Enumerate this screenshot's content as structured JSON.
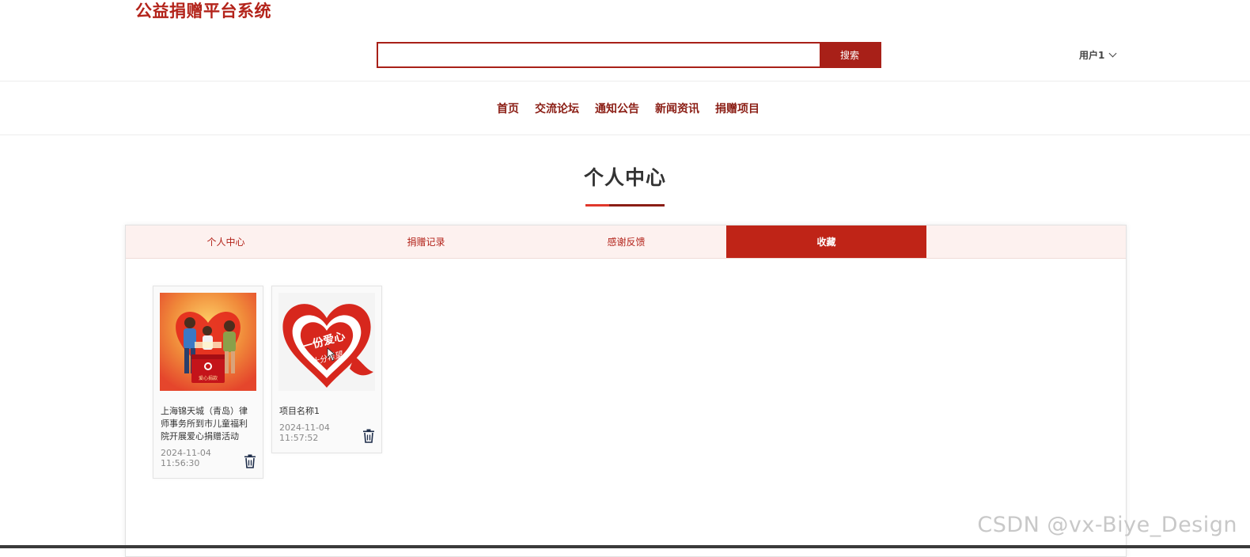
{
  "header": {
    "brand": "公益捐赠平台系统",
    "search": {
      "value": "",
      "placeholder": "",
      "button_label": "搜索"
    },
    "user_label": "用户1"
  },
  "nav": {
    "items": [
      {
        "label": "首页"
      },
      {
        "label": "交流论坛"
      },
      {
        "label": "通知公告"
      },
      {
        "label": "新闻资讯"
      },
      {
        "label": "捐赠项目"
      }
    ]
  },
  "main": {
    "title": "个人中心",
    "tabs": [
      {
        "label": "个人中心",
        "active": false
      },
      {
        "label": "捐赠记录",
        "active": false
      },
      {
        "label": "感谢反馈",
        "active": false
      },
      {
        "label": "收藏",
        "active": true
      }
    ],
    "favorites": [
      {
        "name": "上海锦天城（青岛）律师事务所到市儿童福利院开展爱心捐赠活动",
        "date": "2024-11-04",
        "time": "11:56:30",
        "image_text": "爱心捐款"
      },
      {
        "name": "项目名称1",
        "date": "2024-11-04",
        "time": "11:57:52",
        "image_text_1": "一份爱心",
        "image_text_2": "十分希望"
      }
    ]
  },
  "watermark": "CSDN @vx-Biye_Design",
  "colors": {
    "brand": "#b3231a",
    "accent": "#bf2417",
    "nav_text": "#8b1e15",
    "tab_bg": "#fdf1ef"
  }
}
